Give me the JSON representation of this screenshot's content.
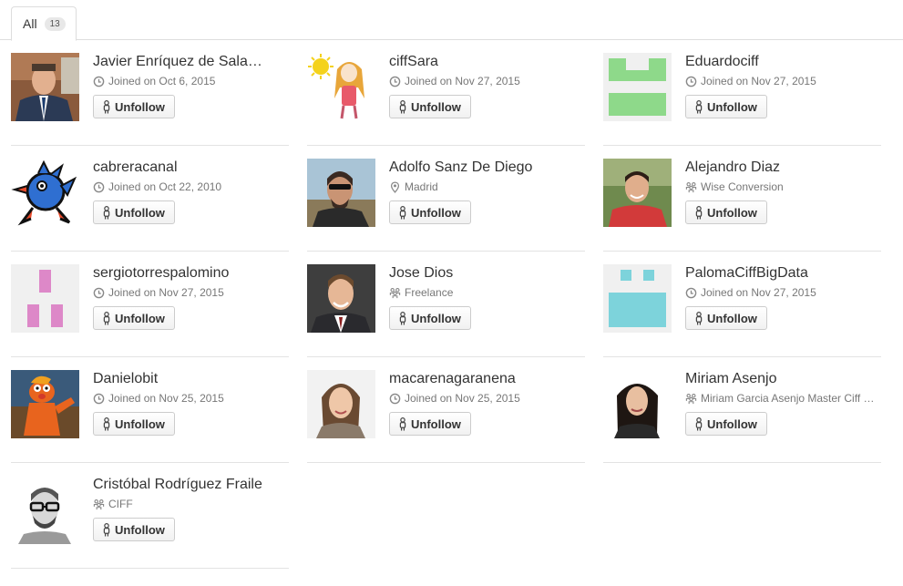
{
  "tabs": [
    {
      "label": "All",
      "count": "13"
    }
  ],
  "button_label": "Unfollow",
  "users": [
    {
      "name": "Javier Enríquez de Sala…",
      "meta": "Joined on Oct 6, 2015",
      "meta_icon": "clock-icon"
    },
    {
      "name": "ciffSara",
      "meta": "Joined on Nov 27, 2015",
      "meta_icon": "clock-icon"
    },
    {
      "name": "Eduardociff",
      "meta": "Joined on Nov 27, 2015",
      "meta_icon": "clock-icon"
    },
    {
      "name": "cabreracanal",
      "meta": "Joined on Oct 22, 2010",
      "meta_icon": "clock-icon"
    },
    {
      "name": "Adolfo Sanz De Diego",
      "meta": "Madrid",
      "meta_icon": "location-pin-icon"
    },
    {
      "name": "Alejandro Diaz",
      "meta": "Wise Conversion",
      "meta_icon": "organization-icon"
    },
    {
      "name": "sergiotorrespalomino",
      "meta": "Joined on Nov 27, 2015",
      "meta_icon": "clock-icon"
    },
    {
      "name": "Jose Dios",
      "meta": "Freelance",
      "meta_icon": "organization-icon"
    },
    {
      "name": "PalomaCiffBigData",
      "meta": "Joined on Nov 27, 2015",
      "meta_icon": "clock-icon"
    },
    {
      "name": "Danielobit",
      "meta": "Joined on Nov 25, 2015",
      "meta_icon": "clock-icon"
    },
    {
      "name": "macarenagaranena",
      "meta": "Joined on Nov 25, 2015",
      "meta_icon": "clock-icon"
    },
    {
      "name": "Miriam Asenjo",
      "meta": "Miriam Garcia Asenjo Master Ciff …",
      "meta_icon": "organization-icon"
    },
    {
      "name": "Cristóbal Rodríguez Fraile",
      "meta": "CIFF",
      "meta_icon": "organization-icon"
    }
  ],
  "colors": {
    "identicon_green": "#8ed98a",
    "identicon_pink": "#dd88c8",
    "identicon_teal": "#7dd3db",
    "identicon_bg": "#f0f0f0",
    "muted_text": "#777777",
    "border": "#dddddd"
  }
}
